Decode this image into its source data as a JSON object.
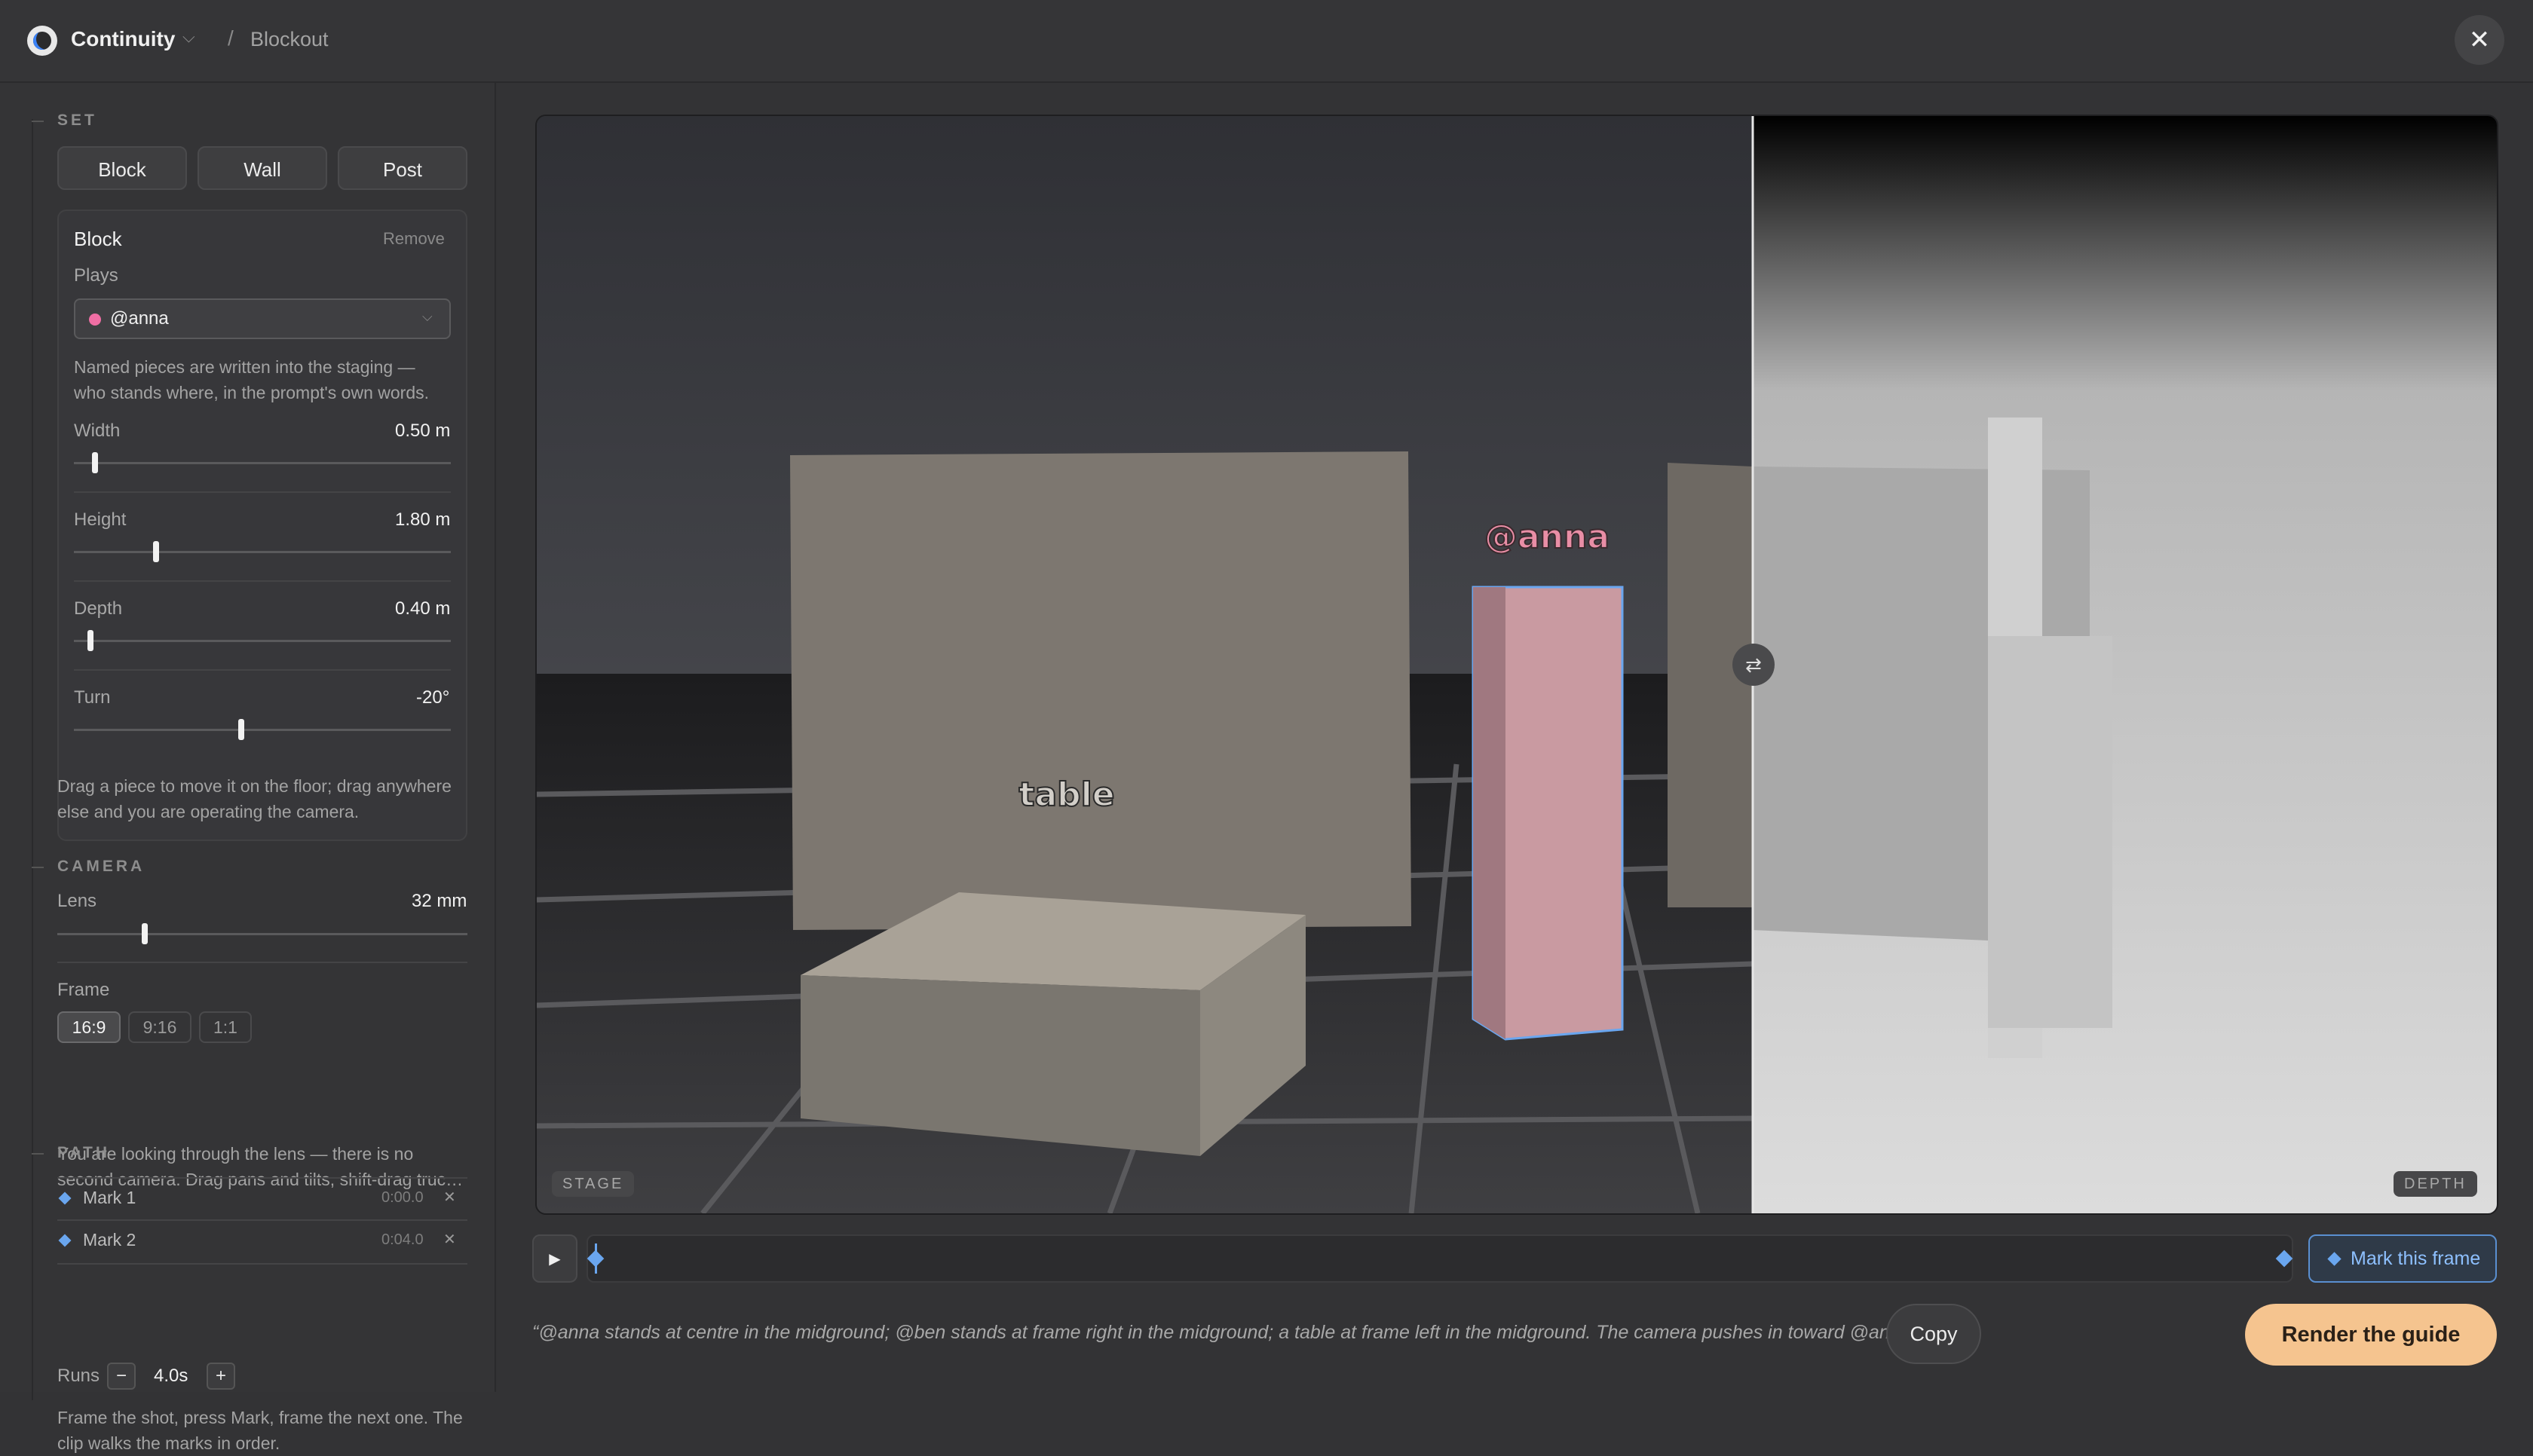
{
  "header": {
    "app_name": "Continuity",
    "breadcrumb_sep": "/",
    "breadcrumb": "Blockout",
    "close_glyph": "✕"
  },
  "sidebar": {
    "set": {
      "label": "SET",
      "piece_buttons": [
        "Block",
        "Wall",
        "Post"
      ],
      "selected": {
        "name": "Block",
        "remove_label": "Remove",
        "plays_label": "Plays",
        "plays_value": "@anna",
        "plays_color": "#f06ea4",
        "note": [
          "Named pieces are written into the staging —",
          "who stands where, in the prompt's own words."
        ],
        "sliders": [
          {
            "label": "Width",
            "value": "0.50 m",
            "fraction": 0.04
          },
          {
            "label": "Height",
            "value": "1.80 m",
            "fraction": 0.2
          },
          {
            "label": "Depth",
            "value": "0.40 m",
            "fraction": 0.03
          },
          {
            "label": "Turn",
            "value": "-20°",
            "fraction": 0.44
          }
        ]
      },
      "help": [
        "Drag a piece to move it on the floor; drag anywhere",
        "else and you are operating the camera."
      ]
    },
    "camera": {
      "label": "CAMERA",
      "lens_label": "Lens",
      "lens_value": "32 mm",
      "lens_fraction": 0.2,
      "frame_label": "Frame",
      "frame_options": [
        "16:9",
        "9:16",
        "1:1"
      ],
      "frame_selected": "16:9",
      "help": [
        "You are looking through the lens — there is no",
        "second camera. Drag pans and tilts, shift-drag truc…"
      ]
    },
    "path": {
      "label": "PATH",
      "marks": [
        {
          "name": "Mark 1",
          "time": "0:00.0"
        },
        {
          "name": "Mark 2",
          "time": "0:04.0"
        }
      ],
      "remove_glyph": "✕",
      "runs_label": "Runs",
      "runs_value": "4.0s",
      "minus": "−",
      "plus": "+",
      "help": [
        "Frame the shot, press Mark, frame the next one. The",
        "clip walks the marks in order."
      ]
    }
  },
  "viewport": {
    "stage_tag": "STAGE",
    "depth_tag": "DEPTH",
    "label_table": "table",
    "label_anna": "@anna",
    "swap_glyph": "⇄"
  },
  "timeline": {
    "play_glyph": "▶",
    "mark_button": "Mark this frame",
    "key_positions": [
      0,
      1
    ]
  },
  "footer": {
    "prompt": "“@anna stands at centre in the midground; @ben stands at frame right in the midground; a table at frame left in the midground. The camera pushes in toward @anna.”",
    "copy_label": "Copy",
    "render_label": "Render the guide"
  },
  "colors": {
    "accent_blue": "#6aa6ef",
    "anna_pink": "#f06ea4",
    "render_orange": "#f5c48f"
  }
}
